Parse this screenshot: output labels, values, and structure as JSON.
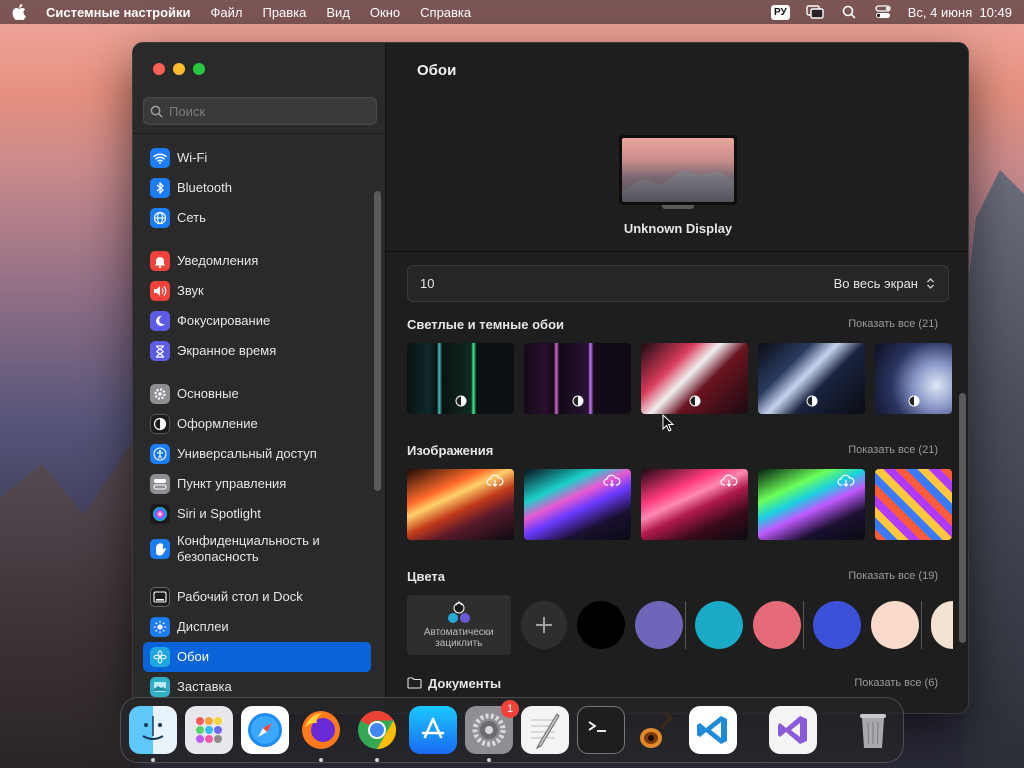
{
  "menubar": {
    "app_name": "Системные настройки",
    "items": [
      "Файл",
      "Правка",
      "Вид",
      "Окно",
      "Справка"
    ],
    "keyboard_layout": "РУ",
    "datetime": "Вс, 4 июня  10:49"
  },
  "sidebar": {
    "search_placeholder": "Поиск",
    "groups": [
      [
        {
          "label": "Wi-Fi",
          "icon": "wifi-icon",
          "color": "#1b7cf5"
        },
        {
          "label": "Bluetooth",
          "icon": "bluetooth-icon",
          "color": "#1b7cf5"
        },
        {
          "label": "Сеть",
          "icon": "globe-icon",
          "color": "#1b7cf5"
        }
      ],
      [
        {
          "label": "Уведомления",
          "icon": "bell-icon",
          "color": "#f2403a"
        },
        {
          "label": "Звук",
          "icon": "speaker-icon",
          "color": "#f2403a"
        },
        {
          "label": "Фокусирование",
          "icon": "moon-icon",
          "color": "#5e5ce6"
        },
        {
          "label": "Экранное время",
          "icon": "hourglass-icon",
          "color": "#5e5ce6"
        }
      ],
      [
        {
          "label": "Основные",
          "icon": "gear-icon",
          "color": "#8e8e93"
        },
        {
          "label": "Оформление",
          "icon": "appearance-icon",
          "color": "#1c1c1e"
        },
        {
          "label": "Универсальный доступ",
          "icon": "accessibility-icon",
          "color": "#1b7cf5"
        },
        {
          "label": "Пункт управления",
          "icon": "control-center-icon",
          "color": "#8e8e93"
        },
        {
          "label": "Siri и Spotlight",
          "icon": "siri-icon",
          "color": "#1c1c1e"
        },
        {
          "label": "Конфиденциальность и безопасность",
          "icon": "hand-icon",
          "color": "#1b7cf5"
        }
      ],
      [
        {
          "label": "Рабочий стол и Dock",
          "icon": "dock-icon",
          "color": "#1c1c1e"
        },
        {
          "label": "Дисплеи",
          "icon": "sun-icon",
          "color": "#1b7cf5"
        },
        {
          "label": "Обои",
          "icon": "flower-icon",
          "color": "#1fa8e0",
          "selected": true
        },
        {
          "label": "Заставка",
          "icon": "screensaver-icon",
          "color": "#30b0c7"
        }
      ]
    ]
  },
  "main": {
    "title": "Обои",
    "display_name": "Unknown Display",
    "picker_value": "10",
    "picker_mode": "Во весь экран",
    "sections": [
      {
        "title": "Светлые и темные обои",
        "link": "Показать все (21)"
      },
      {
        "title": "Изображения",
        "link": "Показать все (21)"
      },
      {
        "title": "Цвета",
        "link": "Показать все (19)"
      },
      {
        "title": "Документы",
        "link": "Показать все (6)"
      }
    ],
    "auto_label": "Автоматически зациклить",
    "swatches": [
      "#000000",
      "#6e66b8",
      "#1aabc8",
      "#e56b78",
      "#3b51d8",
      "#fadacb",
      "#f4e2d2"
    ]
  },
  "dock": {
    "apps": [
      {
        "name": "finder",
        "running": true
      },
      {
        "name": "launchpad",
        "running": false
      },
      {
        "name": "safari",
        "running": false
      },
      {
        "name": "firefox",
        "running": true
      },
      {
        "name": "chrome",
        "running": true
      },
      {
        "name": "app-store",
        "running": false
      },
      {
        "name": "system-settings",
        "running": true,
        "badge": "1"
      },
      {
        "name": "textedit",
        "running": false
      },
      {
        "name": "terminal",
        "running": false
      },
      {
        "name": "garageband",
        "running": false
      },
      {
        "name": "vscode",
        "running": false
      },
      {
        "name": "visual-studio",
        "running": false
      },
      {
        "name": "trash",
        "running": false
      }
    ]
  }
}
